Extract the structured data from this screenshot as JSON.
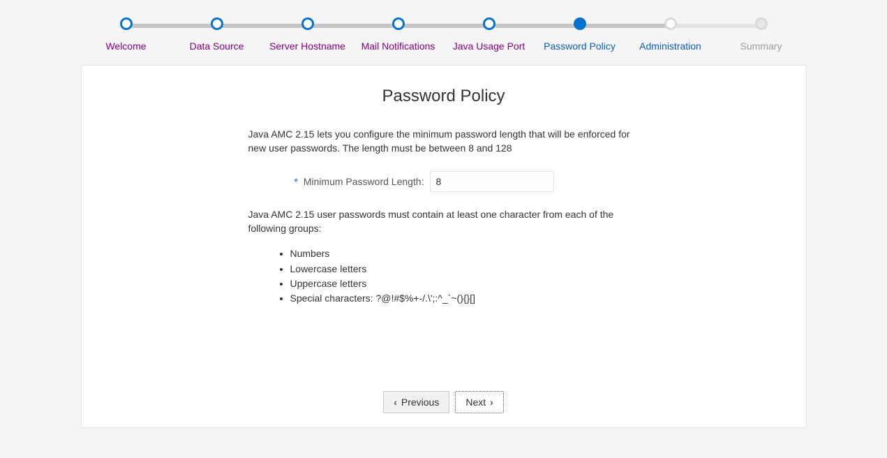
{
  "wizard": {
    "steps": [
      {
        "label": "Welcome",
        "state": "visited"
      },
      {
        "label": "Data Source",
        "state": "visited"
      },
      {
        "label": "Server Hostname",
        "state": "visited"
      },
      {
        "label": "Mail Notifications",
        "state": "visited"
      },
      {
        "label": "Java Usage Port",
        "state": "visited"
      },
      {
        "label": "Password Policy",
        "state": "current"
      },
      {
        "label": "Administration",
        "state": "future"
      },
      {
        "label": "Summary",
        "state": "disabled"
      }
    ]
  },
  "page": {
    "title": "Password Policy",
    "intro": "Java AMC 2.15 lets you configure the minimum password length that will be enforced for new user passwords. The length must be between 8 and 128",
    "required_marker": "*",
    "min_length_label": "Minimum Password Length:",
    "min_length_value": "8",
    "groups_intro": "Java AMC 2.15 user passwords must contain at least one character from each of the following groups:",
    "groups": [
      "Numbers",
      "Lowercase letters",
      "Uppercase letters",
      "Special characters: ?@!#$%+-/.\\';:^_`~(){}[]"
    ]
  },
  "buttons": {
    "previous": "Previous",
    "next": "Next"
  }
}
